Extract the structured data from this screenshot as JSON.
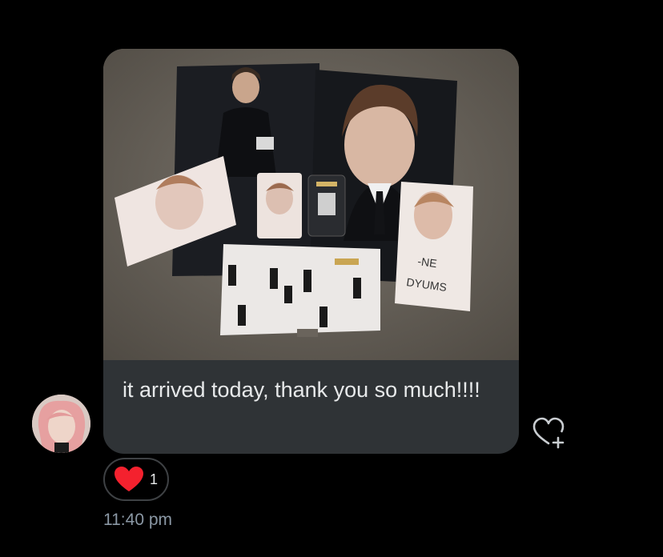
{
  "message": {
    "text": "it arrived today, thank you so much!!!!",
    "timestamp": "11:40 pm",
    "reaction": {
      "icon": "heart-icon",
      "count": "1",
      "color": "#f4212e"
    },
    "react_button_icon": "heart-plus-icon"
  },
  "colors": {
    "background": "#000000",
    "bubble": "#2f3336",
    "text_primary": "#e7e9ea",
    "text_secondary": "#8b98a5"
  }
}
